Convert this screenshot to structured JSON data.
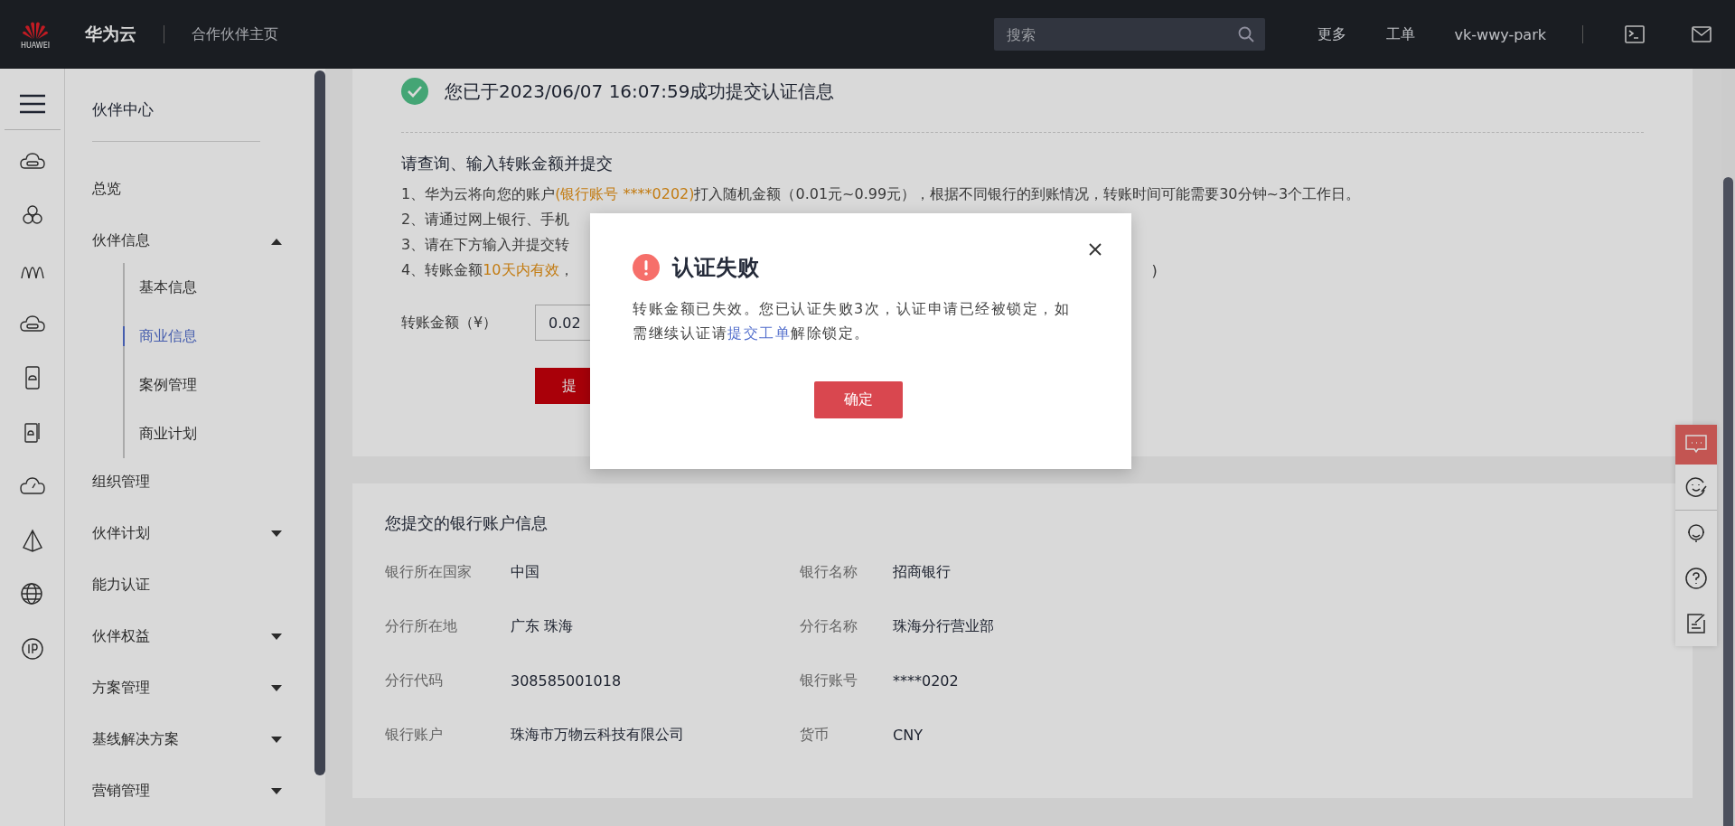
{
  "topbar": {
    "logo_text": "HUAWEI",
    "brand": "华为云",
    "subtitle": "合作伙伴主页",
    "search": {
      "placeholder": "搜索"
    },
    "links": [
      "更多",
      "工单",
      "vk-wwy-park"
    ]
  },
  "nav": {
    "title": "伙伴中心",
    "items": [
      {
        "label": "总览",
        "selected": false
      },
      {
        "label": "伙伴信息",
        "selected": false,
        "expanded": true,
        "children": [
          {
            "label": "基本信息",
            "selected": false
          },
          {
            "label": "商业信息",
            "selected": true
          },
          {
            "label": "案例管理",
            "selected": false
          },
          {
            "label": "商业计划",
            "selected": false
          }
        ]
      },
      {
        "label": "组织管理",
        "selected": false
      },
      {
        "label": "伙伴计划",
        "selected": false,
        "expanded": false
      },
      {
        "label": "能力认证",
        "selected": false
      },
      {
        "label": "伙伴权益",
        "selected": false,
        "expanded": false
      },
      {
        "label": "方案管理",
        "selected": false,
        "expanded": false
      },
      {
        "label": "基线解决方案",
        "selected": false,
        "expanded": false
      },
      {
        "label": "营销管理",
        "selected": false,
        "expanded": false
      }
    ]
  },
  "success_banner": "您已于2023/06/07 16:07:59成功提交认证信息",
  "transfer": {
    "title": "请查询、输入转账金额并提交",
    "steps": [
      {
        "text": "1、华为云将向您的账户",
        "highlight": "(银行账号 ****0202)",
        "rest": "打入随机金额（0.01元~0.99元），根据不同银行的到账情况，转账时间可能需要30分钟~3个工作日。"
      },
      {
        "text": "2、请通过网上银行、手机"
      },
      {
        "text": "3、请在下方输入并提交转"
      },
      {
        "text": "4、转账金额",
        "highlight": "10天内有效",
        "rest": "，",
        "tail": ")"
      }
    ],
    "amount_label": "转账金额（¥）",
    "amount_value": "0.02",
    "submit": "提"
  },
  "bank": {
    "title": "您提交的银行账户信息",
    "fields": [
      {
        "label": "银行所在国家",
        "value": "中国"
      },
      {
        "label": "银行名称",
        "value": "招商银行"
      },
      {
        "label": "分行所在地",
        "value": "广东 珠海"
      },
      {
        "label": "分行名称",
        "value": "珠海分行营业部"
      },
      {
        "label": "分行代码",
        "value": "308585001018"
      },
      {
        "label": "银行账号",
        "value": "****0202"
      },
      {
        "label": "银行账户",
        "value": "珠海市万物云科技有限公司"
      },
      {
        "label": "货币",
        "value": "CNY"
      }
    ]
  },
  "float_tools": [
    {
      "selected": true
    },
    {
      "selected": false
    },
    {
      "selected": false
    },
    {
      "selected": false
    },
    {
      "selected": false
    }
  ],
  "modal": {
    "title": "认证失败",
    "message_before": "转账金额已失效。您已认证失败3次，认证申请已经被锁定，如需继续认证请",
    "link": "提交工单",
    "message_after": "解除锁定。",
    "ok": "确定"
  }
}
